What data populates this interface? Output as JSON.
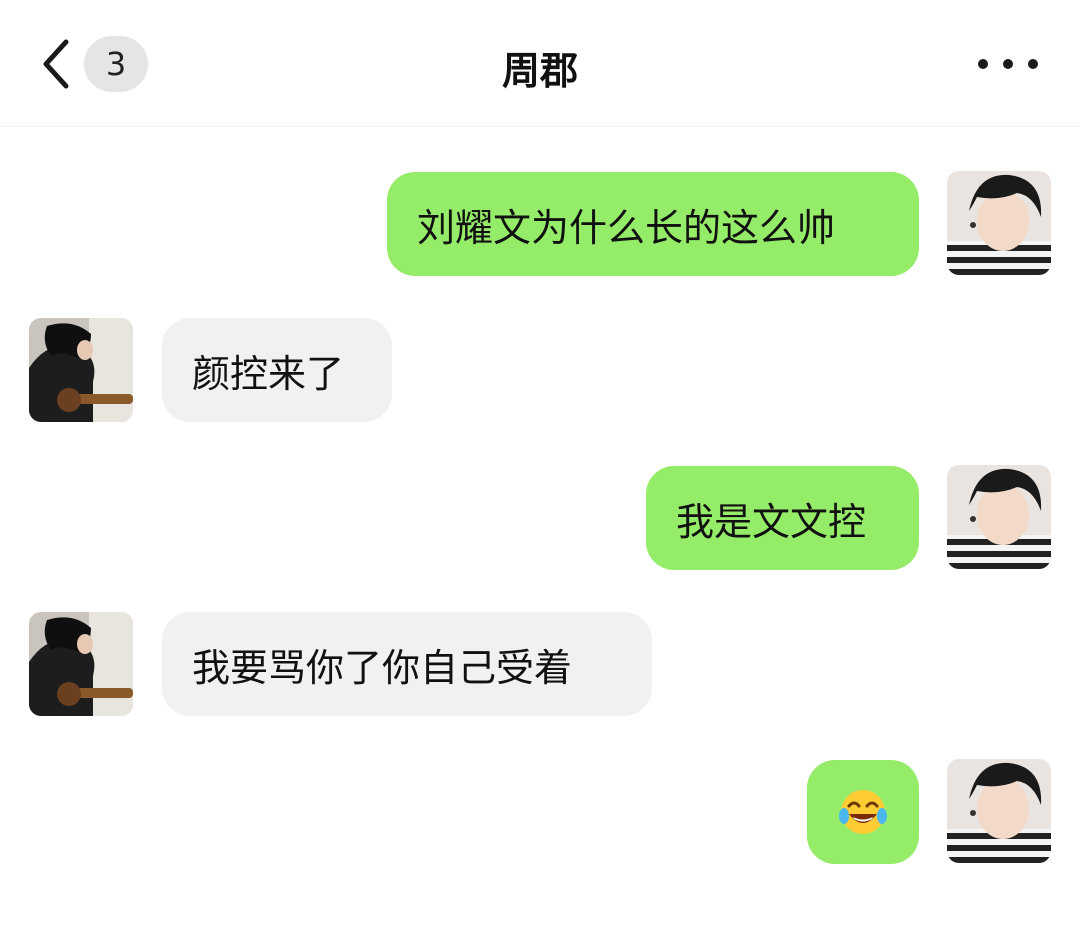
{
  "header": {
    "title": "周郡",
    "unread_count": "3",
    "back_icon": "chevron-left-icon",
    "more_icon": "more-horizontal-icon"
  },
  "colors": {
    "sent_bubble": "#95ec69",
    "received_bubble": "#f1f1f1",
    "background": "#ffffff"
  },
  "messages": [
    {
      "direction": "sent",
      "text": "刘耀文为什么长的这么帅"
    },
    {
      "direction": "received",
      "text": "颜控来了"
    },
    {
      "direction": "sent",
      "text": "我是文文控"
    },
    {
      "direction": "received",
      "text": "我要骂你了你自己受着"
    },
    {
      "direction": "sent",
      "emoji": "laughing-with-tears-emoji"
    }
  ]
}
